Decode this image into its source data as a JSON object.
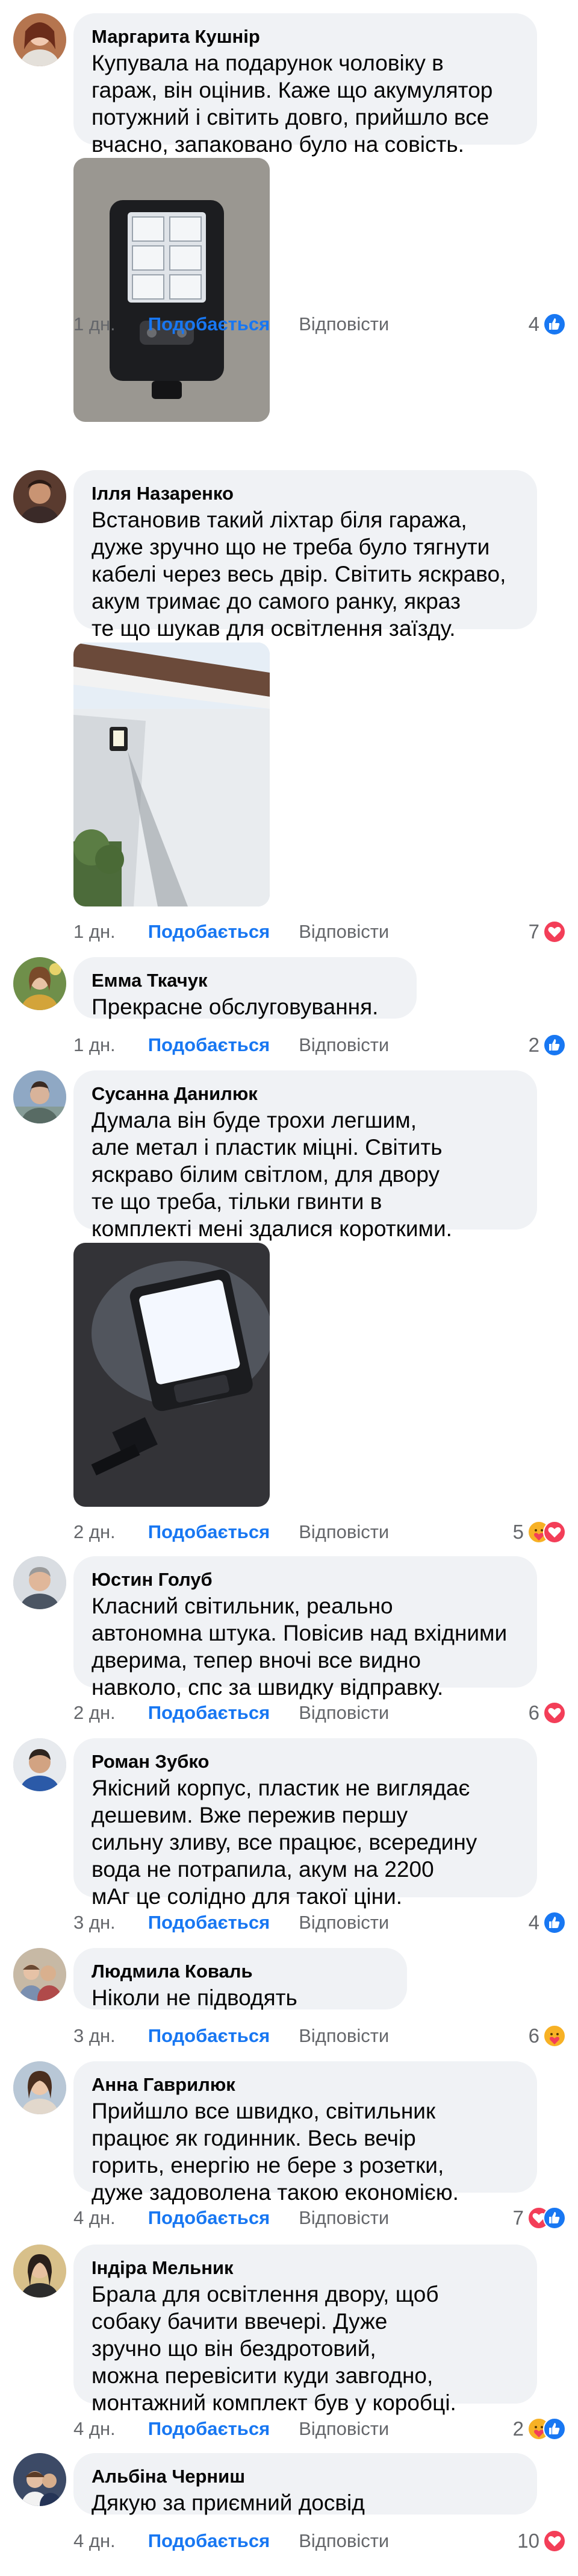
{
  "actions": {
    "like": "Подобається",
    "reply": "Відповісти"
  },
  "colors": {
    "like_blue": "#1877f2",
    "love_red": "#f33e58",
    "care_yellow": "#f7b125",
    "muted": "#65676b",
    "bubble": "#f0f2f5"
  },
  "comments": [
    {
      "author": "Маргарита Кушнір",
      "text": "Купувала на подарунок чоловіку в\nгараж, він оцінив. Каже що акумулятор\nпотужний і світить довго, прийшло все\nвчасно, запаковано було на совість.",
      "time": "1 дн.",
      "reaction_count": "4",
      "reactions": [
        "like-icon"
      ],
      "has_photo": true
    },
    {
      "author": "Ілля Назаренко",
      "text": "Встановив такий ліхтар біля гаража,\nдуже зручно що не треба було тягнути\nкабелі через весь двір. Світить яскраво,\nакум тримає до самого ранку, якраз\nте що шукав для освітлення заїзду.",
      "time": "1 дн.",
      "reaction_count": "7",
      "reactions": [
        "love-icon"
      ],
      "has_photo": true
    },
    {
      "author": "Емма Ткачук",
      "text": "Прекрасне обслуговування.",
      "time": "1 дн.",
      "reaction_count": "2",
      "reactions": [
        "like-icon"
      ],
      "has_photo": false
    },
    {
      "author": "Сусанна Данилюк",
      "text": "Думала він буде трохи легшим,\nале метал і пластик міцні. Світить\nяскраво білим світлом, для двору\nте що треба, тільки гвинти в\nкомплекті мені здалися короткими.",
      "time": "2 дн.",
      "reaction_count": "5",
      "reactions": [
        "care-icon",
        "love-icon"
      ],
      "has_photo": true
    },
    {
      "author": "Юстин Голуб",
      "text": "Класний світильник, реально\nавтономна штука. Повісив над вхідними\nдверима, тепер вночі все видно\nнавколо, спс за швидку відправку.",
      "time": "2 дн.",
      "reaction_count": "6",
      "reactions": [
        "love-icon"
      ],
      "has_photo": false
    },
    {
      "author": "Роман Зубко",
      "text": "Якісний корпус, пластик не виглядає\nдешевим. Вже пережив першу\nсильну зливу, все працює, всередину\nвода не потрапила, акум на 2200\nмАг це солідно для такої ціни.",
      "time": "3 дн.",
      "reaction_count": "4",
      "reactions": [
        "like-icon"
      ],
      "has_photo": false
    },
    {
      "author": "Людмила Коваль",
      "text": "Ніколи не підводять",
      "time": "3 дн.",
      "reaction_count": "6",
      "reactions": [
        "care-icon"
      ],
      "has_photo": false
    },
    {
      "author": "Анна Гаврилюк",
      "text": "Прийшло все швидко, світильник\nпрацює як годинник. Весь вечір\nгорить, енергію не бере з розетки,\nдуже задоволена такою економією.",
      "time": "4 дн.",
      "reaction_count": "7",
      "reactions": [
        "love-icon",
        "like-icon"
      ],
      "has_photo": false
    },
    {
      "author": "Індіра Мельник",
      "text": "Брала для освітлення двору, щоб\nсобаку бачити ввечері. Дуже\nзручно що він бездротовий,\nможна перевісити куди завгодно,\nмонтажний комплект був у коробці.",
      "time": "4 дн.",
      "reaction_count": "2",
      "reactions": [
        "care-icon",
        "like-icon"
      ],
      "has_photo": false
    },
    {
      "author": "Альбіна Черниш",
      "text": "Дякую за приємний досвід",
      "time": "4 дн.",
      "reaction_count": "10",
      "reactions": [
        "love-icon"
      ],
      "has_photo": false
    }
  ]
}
